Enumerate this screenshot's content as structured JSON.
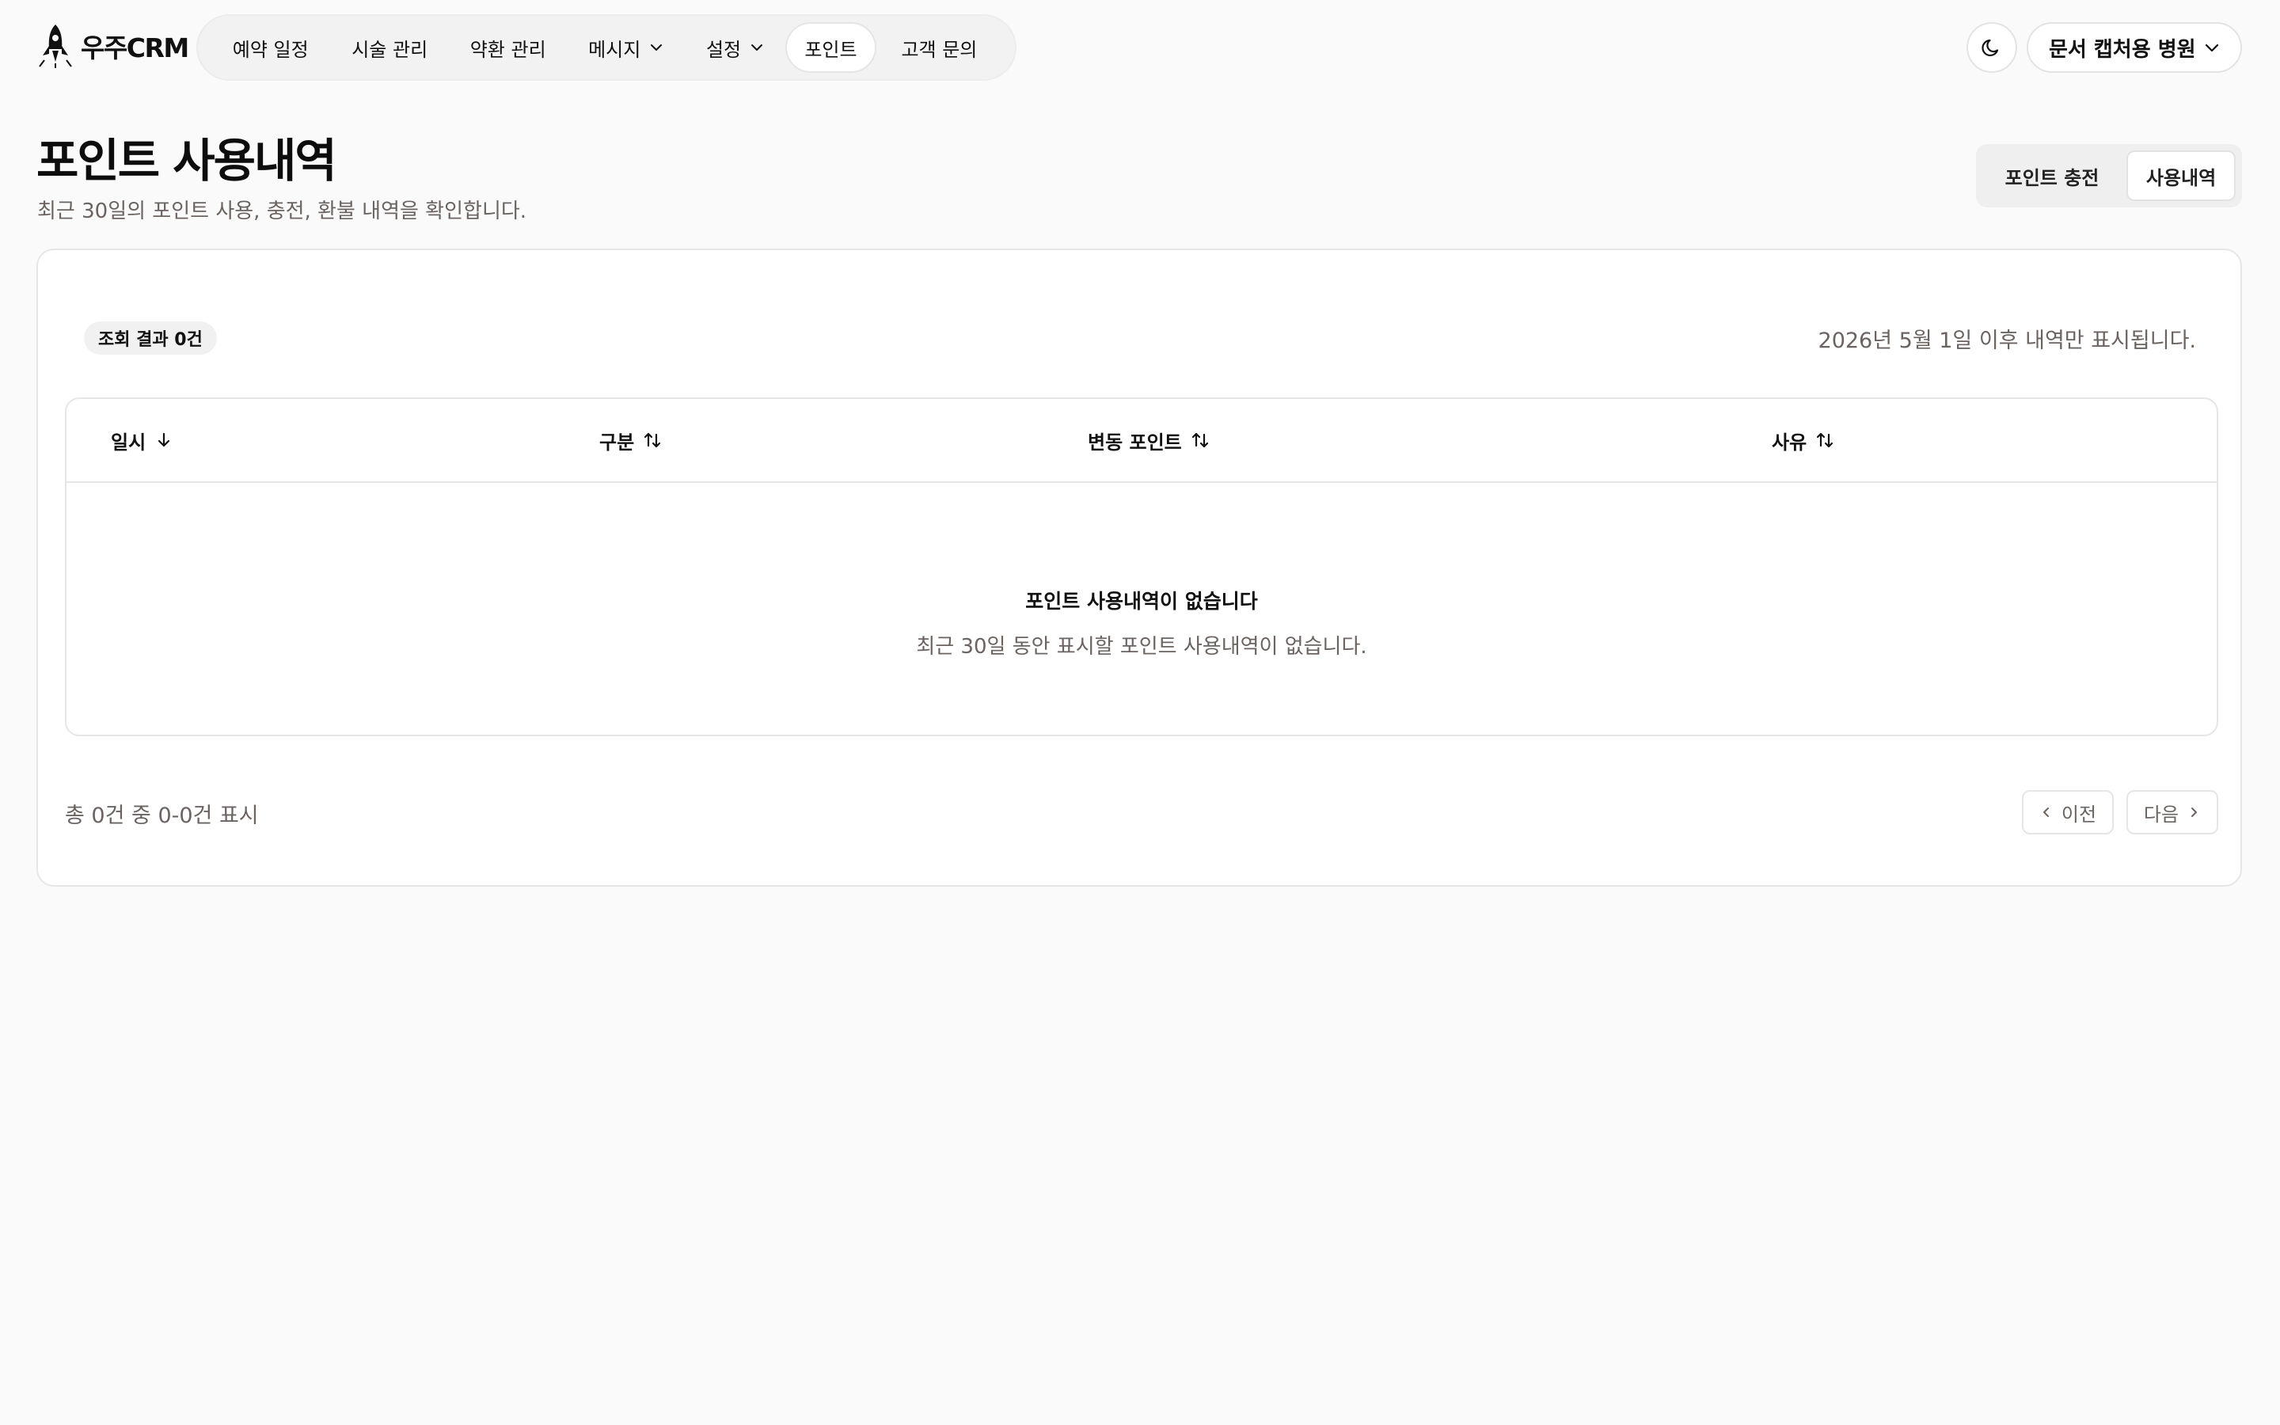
{
  "brand": {
    "name": "우주CRM"
  },
  "nav": {
    "items": [
      {
        "label": "예약 일정",
        "has_dropdown": false,
        "active": false
      },
      {
        "label": "시술 관리",
        "has_dropdown": false,
        "active": false
      },
      {
        "label": "약환 관리",
        "has_dropdown": false,
        "active": false
      },
      {
        "label": "메시지",
        "has_dropdown": true,
        "active": false
      },
      {
        "label": "설정",
        "has_dropdown": true,
        "active": false
      },
      {
        "label": "포인트",
        "has_dropdown": false,
        "active": true
      },
      {
        "label": "고객 문의",
        "has_dropdown": false,
        "active": false
      }
    ]
  },
  "header_right": {
    "theme_icon": "moon-icon",
    "clinic_selector": "문서 캡처용 병원"
  },
  "page": {
    "title": "포인트 사용내역",
    "subtitle": "최근 30일의 포인트 사용, 충전, 환불 내역을 확인합니다.",
    "tabs": [
      {
        "label": "포인트 충전",
        "active": false
      },
      {
        "label": "사용내역",
        "active": true
      }
    ]
  },
  "card": {
    "result_badge": "조회 결과 0건",
    "notice": "2026년 5월 1일 이후 내역만 표시됩니다.",
    "table": {
      "columns": [
        {
          "label": "일시",
          "sort": "desc",
          "sort_icon": "arrow-down-icon"
        },
        {
          "label": "구분",
          "sort": "none",
          "sort_icon": "sort-icon"
        },
        {
          "label": "변동 포인트",
          "sort": "none",
          "sort_icon": "sort-icon"
        },
        {
          "label": "사유",
          "sort": "none",
          "sort_icon": "sort-icon"
        }
      ],
      "rows": [],
      "empty_title": "포인트 사용내역이 없습니다",
      "empty_description": "최근 30일 동안 표시할 포인트 사용내역이 없습니다."
    },
    "pagination": {
      "summary": "총 0건 중 0-0건 표시",
      "prev_label": "이전",
      "next_label": "다음"
    }
  },
  "colors": {
    "background": "#fafafa",
    "card": "#ffffff",
    "border": "#e6e6e6",
    "muted_text": "#6b6360",
    "text": "#111111"
  }
}
